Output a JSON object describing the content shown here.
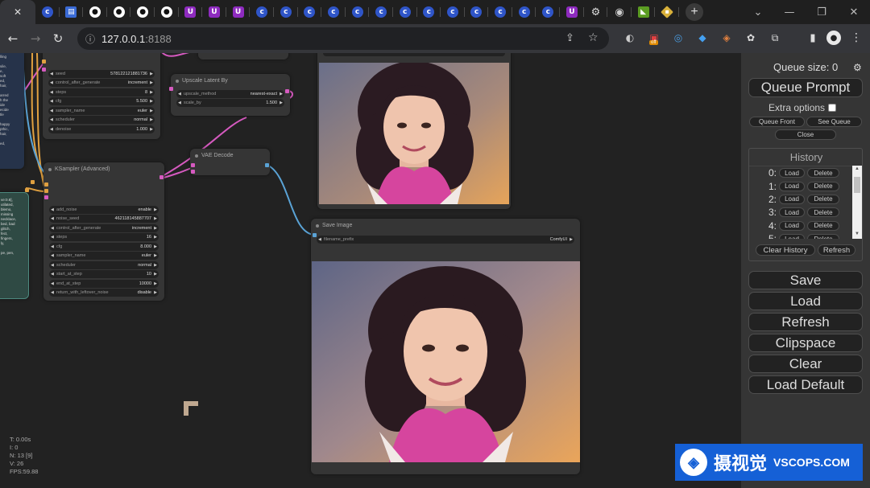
{
  "browser": {
    "tabs": [
      {
        "icon": "close-icon",
        "glyph": "✕"
      },
      {
        "icon": "comfy-icon",
        "glyph": "c"
      },
      {
        "icon": "doc-icon",
        "glyph": "▤"
      },
      {
        "icon": "github-icon",
        "glyph": "●"
      },
      {
        "icon": "github-icon",
        "glyph": "●"
      },
      {
        "icon": "github-icon",
        "glyph": "●"
      },
      {
        "icon": "github-icon",
        "glyph": "●"
      },
      {
        "icon": "u-icon",
        "glyph": "U"
      },
      {
        "icon": "u-icon",
        "glyph": "U"
      },
      {
        "icon": "u-icon",
        "glyph": "U"
      },
      {
        "icon": "comfy-icon",
        "glyph": "c"
      },
      {
        "icon": "comfy-icon",
        "glyph": "c"
      },
      {
        "icon": "comfy-icon",
        "glyph": "c"
      },
      {
        "icon": "comfy-icon",
        "glyph": "c"
      },
      {
        "icon": "comfy-icon",
        "glyph": "c"
      },
      {
        "icon": "comfy-icon",
        "glyph": "c"
      },
      {
        "icon": "comfy-icon",
        "glyph": "c"
      },
      {
        "icon": "comfy-icon",
        "glyph": "c"
      },
      {
        "icon": "comfy-icon",
        "glyph": "c"
      },
      {
        "icon": "comfy-icon",
        "glyph": "c"
      },
      {
        "icon": "comfy-icon",
        "glyph": "c"
      },
      {
        "icon": "comfy-icon",
        "glyph": "c"
      },
      {
        "icon": "comfy-icon",
        "glyph": "c"
      },
      {
        "icon": "u-icon",
        "glyph": "U"
      },
      {
        "icon": "gear-icon",
        "glyph": "⚙"
      },
      {
        "icon": "globe-icon",
        "glyph": "◉"
      },
      {
        "icon": "nvidia-icon",
        "glyph": "◣"
      },
      {
        "icon": "diamond-icon",
        "glyph": "◆"
      }
    ],
    "new_tab_glyph": "+",
    "window_controls": {
      "chevron": "⌄",
      "minimize": "—",
      "restore": "❐",
      "close": "✕"
    },
    "nav": {
      "back": "←",
      "forward": "→",
      "reload": "↻"
    },
    "info_glyph": "ⓘ",
    "url_host": "127.0.0.1",
    "url_port": ":8188",
    "share_glyph": "⇪",
    "star_glyph": "☆",
    "extensions": [
      "◐",
      "▣",
      "◎",
      "◆",
      "◈",
      "✿",
      "⧉"
    ],
    "extension_badge": "off",
    "profile_glyph": "●",
    "menu_glyph": "⋮"
  },
  "nodes": {
    "sampler_top": {
      "widgets": [
        {
          "label": "seed",
          "value": "578122121881736"
        },
        {
          "label": "control_after_generate",
          "value": "increment"
        },
        {
          "label": "steps",
          "value": "8"
        },
        {
          "label": "cfg",
          "value": "5.500"
        },
        {
          "label": "sampler_name",
          "value": "euler"
        },
        {
          "label": "scheduler",
          "value": "normal"
        },
        {
          "label": "denoise",
          "value": "1.000"
        }
      ]
    },
    "upscale": {
      "title": "Upscale Latent By",
      "widgets": [
        {
          "label": "upscale_method",
          "value": "nearest-exact"
        },
        {
          "label": "scale_by",
          "value": "1.500"
        }
      ]
    },
    "vae_decode": {
      "title": "VAE Decode"
    },
    "ksampler_adv": {
      "title": "KSampler (Advanced)",
      "widgets": [
        {
          "label": "add_noise",
          "value": "enable"
        },
        {
          "label": "noise_seed",
          "value": "462118145887707"
        },
        {
          "label": "control_after_generate",
          "value": "increment"
        },
        {
          "label": "steps",
          "value": "16"
        },
        {
          "label": "cfg",
          "value": "8.000"
        },
        {
          "label": "sampler_name",
          "value": "euler"
        },
        {
          "label": "scheduler",
          "value": "normal"
        },
        {
          "label": "start_at_step",
          "value": "10"
        },
        {
          "label": "end_at_step",
          "value": "10000"
        },
        {
          "label": "return_with_leftover_noise",
          "value": "disable"
        }
      ]
    },
    "preview_top": {
      "widgets": [
        {
          "label": "",
          "value": ""
        }
      ]
    },
    "save_image": {
      "title": "Save Image",
      "widgets": [
        {
          "label": "filename_prefix",
          "value": "ComfyUI"
        }
      ]
    },
    "prompt_snippets": {
      "top": [
        "lling",
        "",
        "sile,",
        "e,",
        "soft",
        "ed,",
        "hair,",
        "",
        "arred",
        "h the",
        "ide",
        "ecide",
        "tle",
        "",
        "happy",
        "pthic,",
        "hair,",
        "",
        "ed,"
      ],
      "bottom": [
        "ve:0.8],",
        "utilated,",
        "blemo,",
        "missing",
        "necklace,",
        "bed, bad",
        "glitch,",
        "fect,",
        "fingers,",
        "ly,",
        "",
        "pe, pen,"
      ]
    }
  },
  "stats": {
    "time": "T: 0.00s",
    "i": "I: 0",
    "n": "N: 13 [9]",
    "v": "V: 26",
    "fps": "FPS:59.88"
  },
  "menu": {
    "queue_size": "Queue size: 0",
    "gear_glyph": "⚙",
    "queue_prompt": "Queue Prompt",
    "extra_options": "Extra options",
    "queue_front": "Queue Front",
    "see_queue": "See Queue",
    "close": "Close",
    "history_title": "History",
    "history": [
      {
        "index": "0:",
        "load": "Load",
        "delete": "Delete"
      },
      {
        "index": "1:",
        "load": "Load",
        "delete": "Delete"
      },
      {
        "index": "2:",
        "load": "Load",
        "delete": "Delete"
      },
      {
        "index": "3:",
        "load": "Load",
        "delete": "Delete"
      },
      {
        "index": "4:",
        "load": "Load",
        "delete": "Delete"
      },
      {
        "index": "5:",
        "load": "Load",
        "delete": "Delete"
      }
    ],
    "clear_history": "Clear History",
    "refresh_history": "Refresh",
    "save": "Save",
    "load": "Load",
    "refresh": "Refresh",
    "clipspace": "Clipspace",
    "clear": "Clear",
    "load_default": "Load Default"
  },
  "watermark": {
    "logo_glyph": "◈",
    "cn": "摄视觉",
    "en": "VSCOPS.COM"
  },
  "colors": {
    "link_pink": "#d65ac0",
    "link_blue": "#5aa3d6",
    "link_orange": "#e0a040",
    "port_pink": "#d65ac0",
    "port_blue": "#5aa3d6",
    "port_orange": "#e0a040",
    "accent_blue": "#1560d6"
  }
}
